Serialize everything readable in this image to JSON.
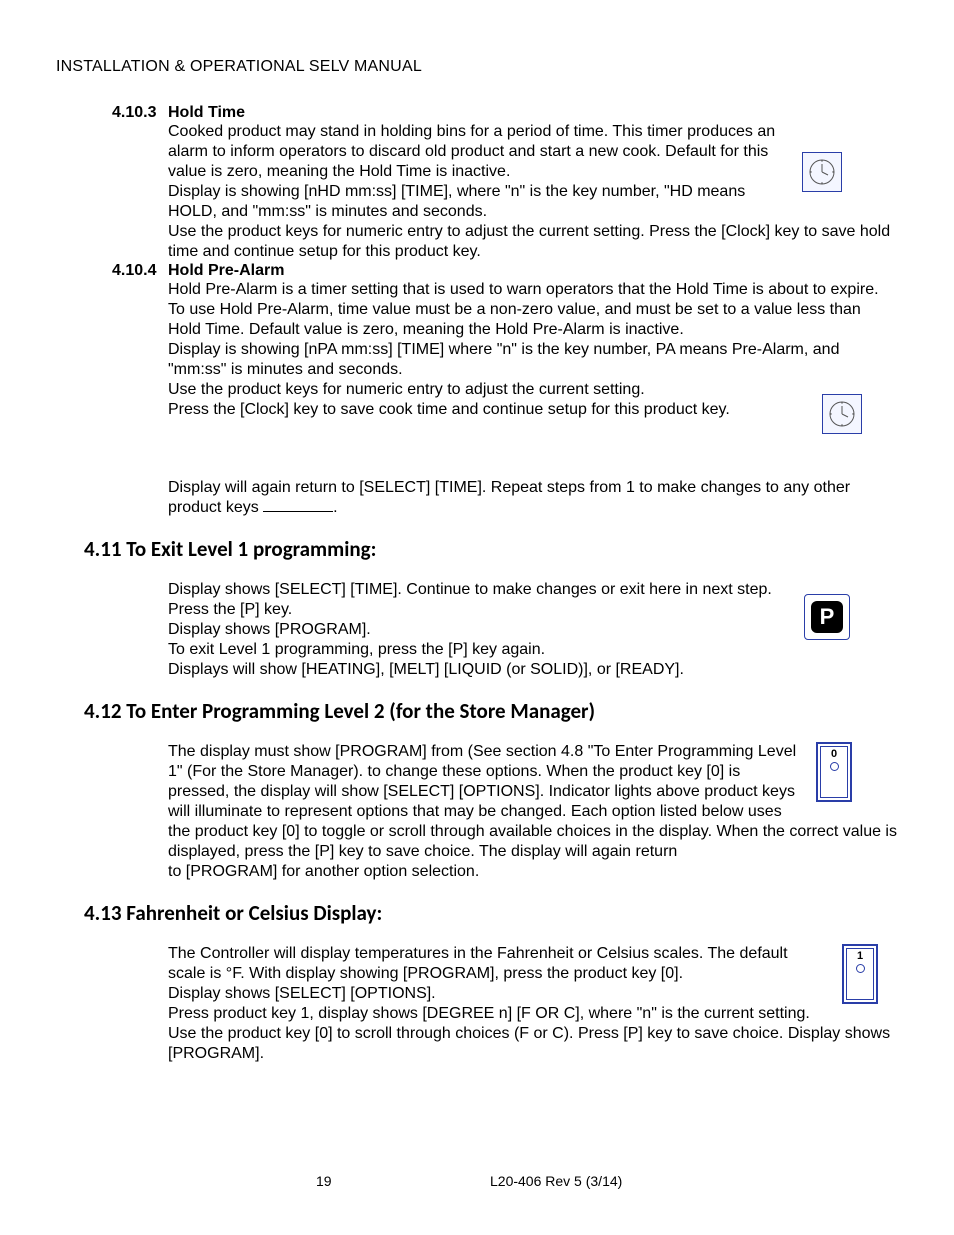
{
  "header": "INSTALLATION & OPERATIONAL SELV MANUAL",
  "s4103": {
    "num": "4.10.3",
    "title": "Hold Time",
    "p1": "Cooked product may stand in holding bins for a period of time.  This timer produces an alarm to inform operators to discard old product and start a new cook. Default for this value is zero, meaning the Hold Time is inactive.",
    "p2": "Display is showing [nHD mm:ss] [TIME], where \"n\" is the key number, \"HD means HOLD, and \"mm:ss\" is minutes and seconds.",
    "p3": "Use the product keys for numeric entry to adjust the current setting.  Press the [Clock] key to save hold time and continue setup for this product key."
  },
  "s4104": {
    "num": "4.10.4",
    "title": "Hold Pre-Alarm",
    "p1": "Hold Pre-Alarm is a timer setting that is used to warn operators that the Hold Time is about to expire.  To use Hold Pre-Alarm, time value must be a non-zero value, and must be set to a value less than Hold Time.  Default value is zero, meaning the Hold Pre-Alarm is inactive.",
    "p2": "Display is showing [nPA mm:ss] [TIME] where \"n\" is the key number, PA means Pre-Alarm, and \"mm:ss\" is minutes and seconds.",
    "p3": "Use the product keys for numeric entry to adjust the current setting.",
    "p4": "Press the [Clock] key to save cook time and continue setup for this product key.",
    "p5a": "Display will again return to [SELECT] [TIME].  Repeat steps from 1 to make changes to any other product keys ",
    "p5b": "."
  },
  "s411": {
    "title": "4.11 To Exit Level 1 programming:",
    "p1": "Display shows [SELECT] [TIME].  Continue to make changes or exit here in next step.",
    "p2": "Press the [P] key.",
    "p3": "Display shows [PROGRAM].",
    "p4": "To exit Level 1 programming, press the [P] key again.",
    "p5": "Displays will show [HEATING], [MELT] [LIQUID (or SOLID)], or [READY]."
  },
  "s412": {
    "title": "4.12 To Enter Programming Level 2 (for the Store Manager)",
    "p1": "The display must show [PROGRAM] from (See section 4.8 \"To Enter Programming Level 1\" (For the Store Manager). to change these options. When the product key [0] is pressed, the display will show [SELECT] [OPTIONS].  Indicator lights above product keys will illuminate to represent options that may be changed.  Each option listed below uses the product key [0] to toggle or scroll through available choices in the display.  When the correct value is displayed, press the [P] key to save choice.  The display will again return",
    "p2": "to [PROGRAM] for another option selection."
  },
  "s413": {
    "title": "4.13 Fahrenheit or Celsius Display:",
    "p1": "The Controller will display temperatures in the Fahrenheit or Celsius scales. The default scale is °F.  With display showing [PROGRAM], press the product key [0].",
    "p2": "Display shows [SELECT] [OPTIONS].",
    "p3": "Press product key 1, display shows [DEGREE n] [F OR C], where \"n\" is the current setting.",
    "p4": "Use the product key [0] to scroll through choices (F or C).  Press [P] key to save choice. Display shows [PROGRAM]."
  },
  "icons": {
    "clock": "clock-icon",
    "p_label": "P",
    "key0": "0",
    "key1": "1"
  },
  "footer": {
    "page": "19",
    "doc": "L20-406   Rev 5 (3/14)"
  }
}
